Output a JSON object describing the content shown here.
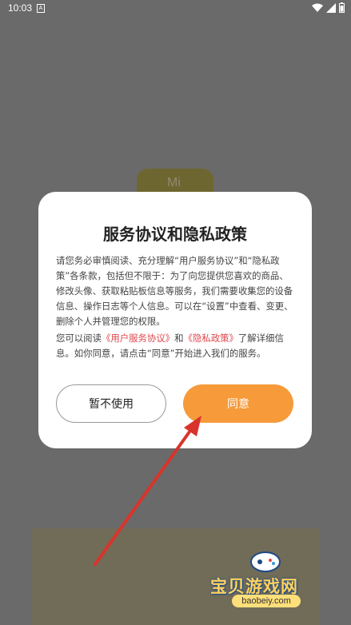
{
  "status_bar": {
    "time": "10:03",
    "sim_label": "A"
  },
  "background": {
    "logo_text": "Mi"
  },
  "dialog": {
    "title": "服务协议和隐私政策",
    "body_text": "请您务必审慎阅读、充分理解“用户服务协议”和“隐私政策”各条款，包括但不限于：为了向您提供您喜欢的商品、修改头像、获取粘贴板信息等服务，我们需要收集您的设备信息、操作日志等个人信息。可以在“设置”中查看、变更、删除个人并管理您的权限。",
    "notice_prefix": "您可以阅读",
    "user_agreement_link": "《用户服务协议》",
    "notice_and": "和",
    "privacy_policy_link": "《隐私政策》",
    "notice_suffix": "了解详细信息。如你同意，请点击“同意”开始进入我们的服务。",
    "decline_button": "暂不使用",
    "agree_button": "同意"
  },
  "watermark": {
    "text": "宝贝游戏网",
    "url": "baobeiy.com"
  },
  "colors": {
    "overlay": "#6a6a6a",
    "accent": "#f69a3a",
    "link": "#e0474c",
    "annotation_arrow": "#d9342b"
  }
}
